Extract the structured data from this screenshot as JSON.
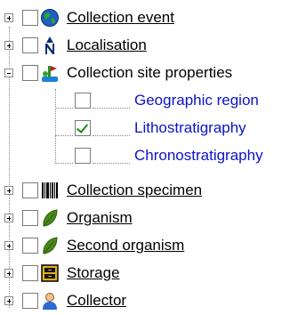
{
  "tree": {
    "items": [
      {
        "label": "Collection event",
        "icon": "globe-icon",
        "expander": "plus",
        "checked": false,
        "style": "underline"
      },
      {
        "label": "Localisation",
        "icon": "north-arrow-icon",
        "expander": "plus",
        "checked": false,
        "style": "underline"
      },
      {
        "label": "Collection site properties",
        "icon": "site-properties-icon",
        "expander": "minus",
        "checked": false,
        "style": "plain"
      },
      {
        "label": "Geographic region",
        "checked": false,
        "style": "link"
      },
      {
        "label": "Lithostratigraphy",
        "checked": true,
        "style": "link"
      },
      {
        "label": "Chronostratigraphy",
        "checked": false,
        "style": "link"
      },
      {
        "label": "Collection specimen",
        "icon": "barcode-icon",
        "expander": "plus",
        "checked": false,
        "style": "underline"
      },
      {
        "label": "Organism",
        "icon": "leaf-icon",
        "expander": "plus",
        "checked": false,
        "style": "underline"
      },
      {
        "label": "Second organism",
        "icon": "leaf-icon",
        "expander": "plus",
        "checked": false,
        "style": "underline"
      },
      {
        "label": "Storage",
        "icon": "storage-cabinet-icon",
        "expander": "plus",
        "checked": false,
        "style": "underline"
      },
      {
        "label": "Collector",
        "icon": "person-icon",
        "expander": "plus",
        "checked": false,
        "style": "underline"
      }
    ]
  },
  "colors": {
    "link": "#0a14c8",
    "check_mark": "#1a8a1a",
    "leaf": "#4a8a1a"
  }
}
